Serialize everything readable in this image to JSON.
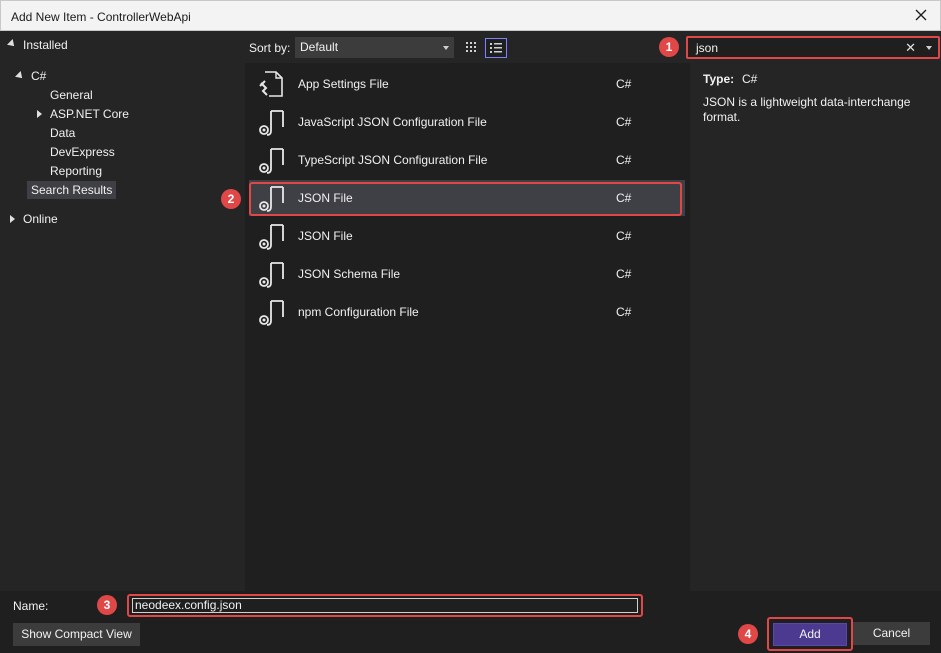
{
  "window": {
    "title": "Add New Item - ControllerWebApi"
  },
  "tree": {
    "installed": "Installed",
    "csharp": "C#",
    "general": "General",
    "aspnet": "ASP.NET Core",
    "data": "Data",
    "devexpress": "DevExpress",
    "reporting": "Reporting",
    "search_results": "Search Results",
    "online": "Online"
  },
  "toolbar": {
    "sort_label": "Sort by:",
    "sort_value": "Default"
  },
  "search": {
    "value": "json",
    "clear_glyph": "✕"
  },
  "items": [
    {
      "name": "App Settings File",
      "lang": "C#",
      "icon": "app-settings-file-icon"
    },
    {
      "name": "JavaScript JSON Configuration File",
      "lang": "C#",
      "icon": "json-file-icon"
    },
    {
      "name": "TypeScript JSON Configuration File",
      "lang": "C#",
      "icon": "json-file-icon"
    },
    {
      "name": "JSON File",
      "lang": "C#",
      "icon": "json-file-icon"
    },
    {
      "name": "JSON File",
      "lang": "C#",
      "icon": "json-file-icon"
    },
    {
      "name": "JSON Schema File",
      "lang": "C#",
      "icon": "json-file-icon"
    },
    {
      "name": "npm Configuration File",
      "lang": "C#",
      "icon": "json-file-icon"
    }
  ],
  "details": {
    "type_label": "Type:",
    "type_value": "C#",
    "description": "JSON is a lightweight data-interchange format."
  },
  "bottom": {
    "name_label": "Name:",
    "name_value": "neodeex.config.json",
    "compact_button": "Show Compact View",
    "add_button": "Add",
    "cancel_button": "Cancel"
  },
  "annotations": [
    "1",
    "2",
    "3",
    "4"
  ],
  "colors": {
    "accent": "#4b3a8f",
    "highlight": "#e04848",
    "background": "#1f1f1f",
    "panel": "#252526"
  }
}
